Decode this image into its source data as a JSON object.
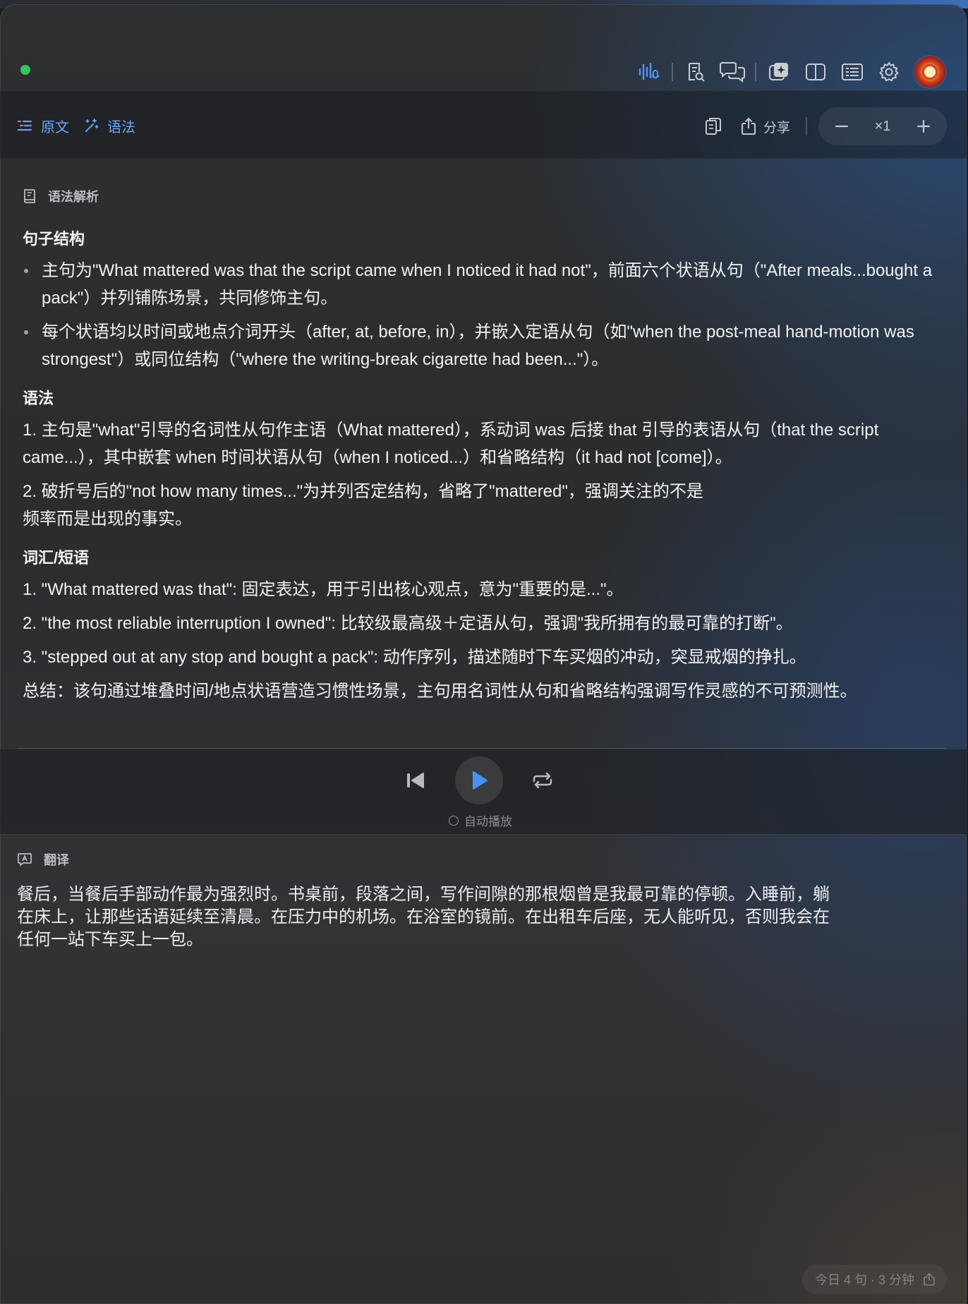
{
  "toolbar": {
    "tab_source": "原文",
    "tab_grammar": "语法",
    "share_label": "分享",
    "zoom_level": "×1"
  },
  "grammar": {
    "section_title": "语法解析",
    "structure_heading": "句子结构",
    "structure_bullets": [
      "主句为\"What mattered was that the script came when I noticed it had not\"，前面六个状语从句（\"After meals...bought a pack\"）并列铺陈场景，共同修饰主句。",
      "每个状语均以时间或地点介词开头（after, at, before, in），并嵌入定语从句（如\"when the post-meal hand-motion was strongest\"）或同位结构（\"where the writing-break cigarette had been...\"）。"
    ],
    "grammar_heading": "语法",
    "grammar_items": [
      "1. 主句是\"what\"引导的名词性从句作主语（What mattered），系动词 was 后接 that 引导的表语从句（that the script came...），其中嵌套 when 时间状语从句（when I noticed...）和省略结构（it had not [come]）。",
      "2. 破折号后的\"not how many times...\"为并列否定结构，省略了\"mattered\"，强调关注的不是\n频率而是出现的事实。"
    ],
    "vocab_heading": "词汇/短语",
    "vocab_items": [
      "1. \"What mattered was that\": 固定表达，用于引出核心观点，意为\"重要的是...\"。",
      "2. \"the most reliable interruption I owned\": 比较级最高级＋定语从句，强调\"我所拥有的最可靠的打断\"。",
      "3. \"stepped out at any stop and bought a pack\": 动作序列，描述随时下车买烟的冲动，突显戒烟的挣扎。"
    ],
    "summary": "总结：该句通过堆叠时间/地点状语营造习惯性场景，主句用名词性从句和省略结构强调写作灵感的不可预测性。"
  },
  "player": {
    "autoplay_label": "自动播放",
    "autoplay_enabled": false
  },
  "translation": {
    "section_title": "翻译",
    "text": "餐后，当餐后手部动作最为强烈时。书桌前，段落之间，写作间隙的那根烟曾是我最可靠的停顿。入睡前，躺\n在床上，让那些话语延续至清晨。在压力中的机场。在浴室的镜前。在出租车后座，无人能听见，否则我会在\n任何一站下车买上一包。"
  },
  "footer": {
    "stats": "今日 4 句 · 3 分钟"
  },
  "colors": {
    "accent": "#5fa0ff",
    "status_dot": "#36c55a",
    "play": "#4a8ff5"
  }
}
